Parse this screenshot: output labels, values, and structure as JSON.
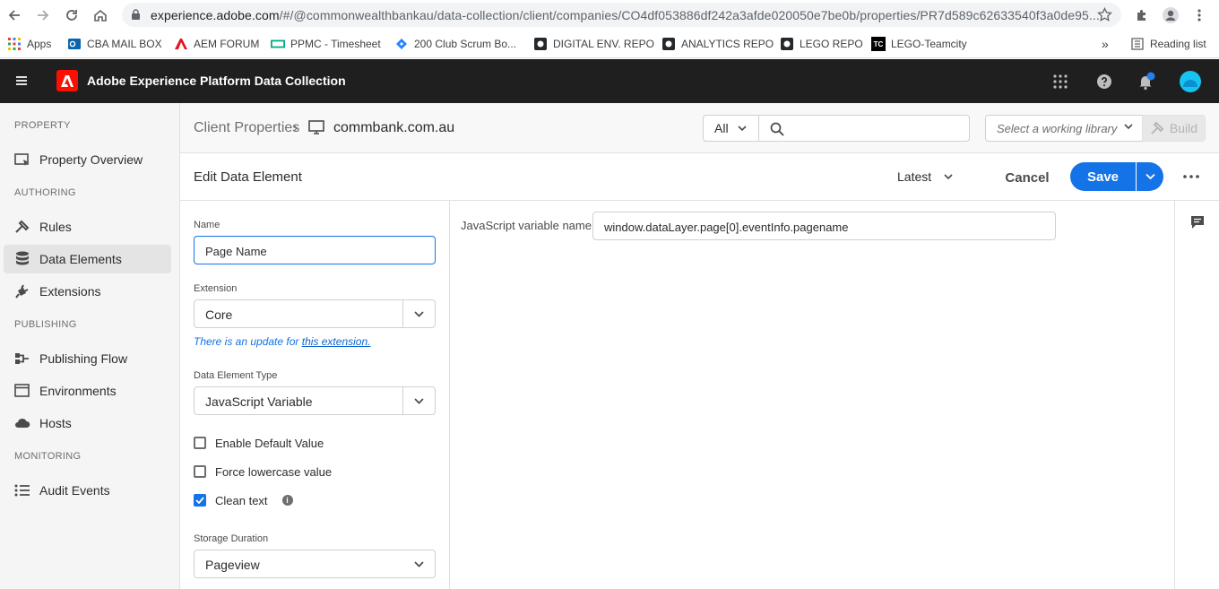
{
  "browser": {
    "url_host": "experience.adobe.com",
    "url_path": "/#/@commonwealthbankau/data-collection/client/companies/CO4df053886df242a3afde020050e7be0b/properties/PR7d589c62633540f3a0de95..."
  },
  "bookmarks": {
    "apps": "Apps",
    "items": [
      "CBA MAIL BOX",
      "AEM FORUM",
      "PPMC - Timesheet",
      "200 Club Scrum Bo...",
      "DIGITAL ENV. REPO",
      "ANALYTICS REPO",
      "LEGO REPO",
      "LEGO-Teamcity"
    ],
    "overflow": "»",
    "reading_list": "Reading list",
    "teamcity_badge": "TC"
  },
  "header": {
    "title": "Adobe Experience Platform Data Collection",
    "accent": "#fa0f00"
  },
  "sidenav": {
    "sections": {
      "property": "PROPERTY",
      "authoring": "AUTHORING",
      "publishing": "PUBLISHING",
      "monitoring": "MONITORING"
    },
    "items": {
      "property_overview": "Property Overview",
      "rules": "Rules",
      "data_elements": "Data Elements",
      "extensions": "Extensions",
      "publishing_flow": "Publishing Flow",
      "environments": "Environments",
      "hosts": "Hosts",
      "audit_events": "Audit Events"
    }
  },
  "topbar": {
    "breadcrumb_root": "Client Properties",
    "breadcrumb_sep": "›",
    "property_name": "commbank.com.au",
    "filter_value": "All",
    "search_value": "",
    "library_placeholder": "Select a working library",
    "build_label": "Build"
  },
  "editbar": {
    "title": "Edit Data Element",
    "revision": "Latest",
    "cancel": "Cancel",
    "save": "Save"
  },
  "form": {
    "name_label": "Name",
    "name_value": "Page Name",
    "extension_label": "Extension",
    "extension_value": "Core",
    "update_prefix": "There is an update for ",
    "update_link": "this extension.",
    "type_label": "Data Element Type",
    "type_value": "JavaScript Variable",
    "enable_default": "Enable Default Value",
    "force_lowercase": "Force lowercase value",
    "clean_text": "Clean text",
    "info_glyph": "i",
    "storage_label": "Storage Duration",
    "storage_value": "Pageview"
  },
  "config": {
    "var_label": "JavaScript variable name",
    "var_value": "window.dataLayer.page[0].eventInfo.pagename"
  },
  "colors": {
    "primary": "#1473e6",
    "header_bg": "#1f1f1f"
  }
}
